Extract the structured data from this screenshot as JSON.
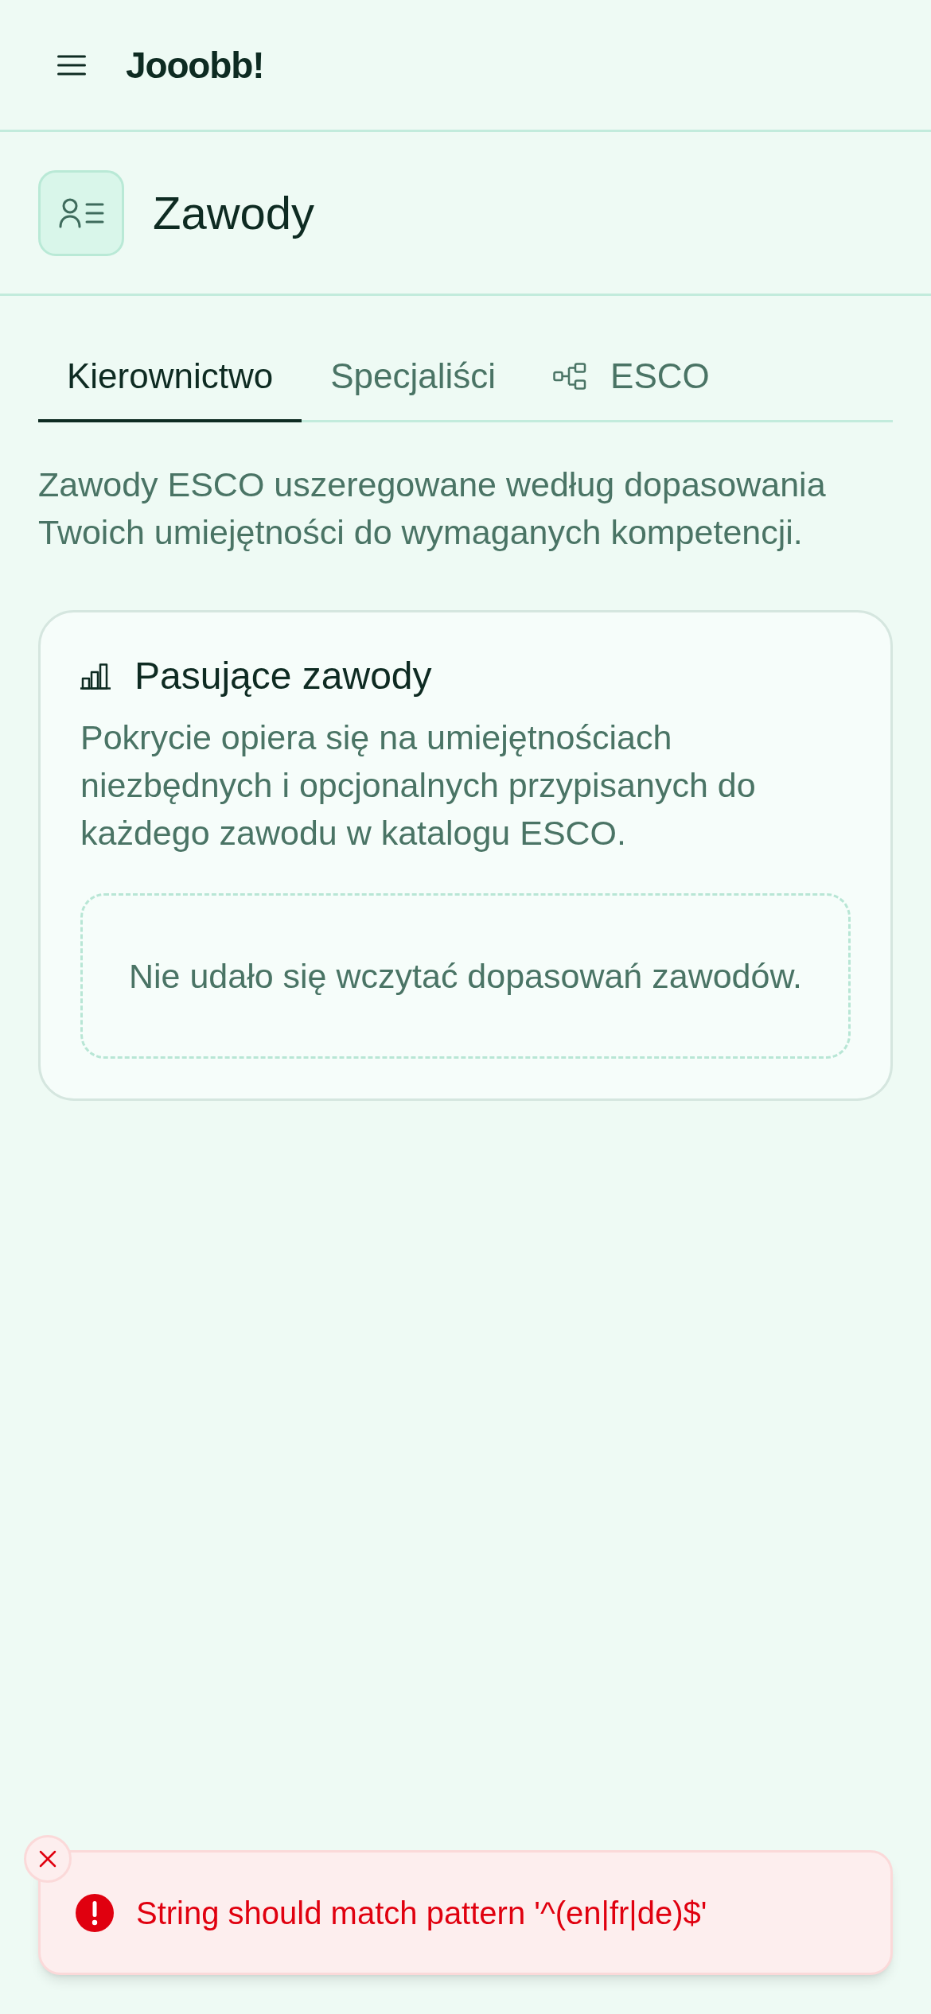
{
  "header": {
    "title": "Jooobb!"
  },
  "page": {
    "title": "Zawody"
  },
  "tabs": [
    {
      "label": "Kierownictwo",
      "selected": true,
      "kind": "plain"
    },
    {
      "label": "Specjaliści",
      "selected": false,
      "kind": "plain"
    },
    {
      "label": "ESCO",
      "selected": false,
      "kind": "with_icon"
    }
  ],
  "intro": "Zawody ESCO uszeregowane według dopasowania Twoich umiejętności do wymaganych kompetencji.",
  "card": {
    "title": "Pasujące zawody",
    "description": "Pokrycie opiera się na umiejętnościach niezbędnych i opcjonalnych przypisanych do każdego zawodu w katalogu ESCO.",
    "empty_message": "Nie udało się wczytać dopasowań zawodów."
  },
  "toast": {
    "kind": "error",
    "message": "String should match pattern '^(en|fr|de)$'"
  }
}
